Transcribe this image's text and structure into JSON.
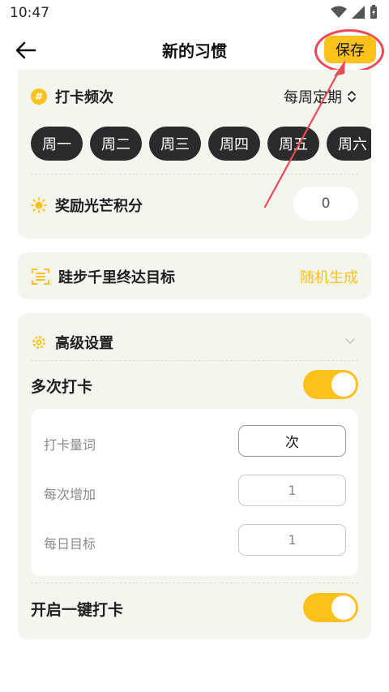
{
  "status_bar": {
    "time": "10:47"
  },
  "app_bar": {
    "title": "新的习惯",
    "save_label": "保存"
  },
  "frequency": {
    "title": "打卡频次",
    "mode": "每周定期",
    "days": [
      "周一",
      "周二",
      "周三",
      "周四",
      "周五",
      "周六"
    ]
  },
  "reward": {
    "title": "奖励光芒积分",
    "points": "0"
  },
  "goal": {
    "title": "跬步千里终达目标",
    "action": "随机生成"
  },
  "advanced": {
    "title": "高级设置",
    "multi_checkin": {
      "label": "多次打卡",
      "enabled": true
    },
    "fields": [
      {
        "label": "打卡量词",
        "value": "次"
      },
      {
        "label": "每次增加",
        "value": "1"
      },
      {
        "label": "每日目标",
        "value": "1"
      }
    ],
    "one_key_checkin": {
      "label": "开启一键打卡",
      "enabled": true
    }
  },
  "colors": {
    "accent": "#fcc21b",
    "highlight": "#ec4a56",
    "chip": "#2b2b2b",
    "card": "#f4f5ef"
  }
}
